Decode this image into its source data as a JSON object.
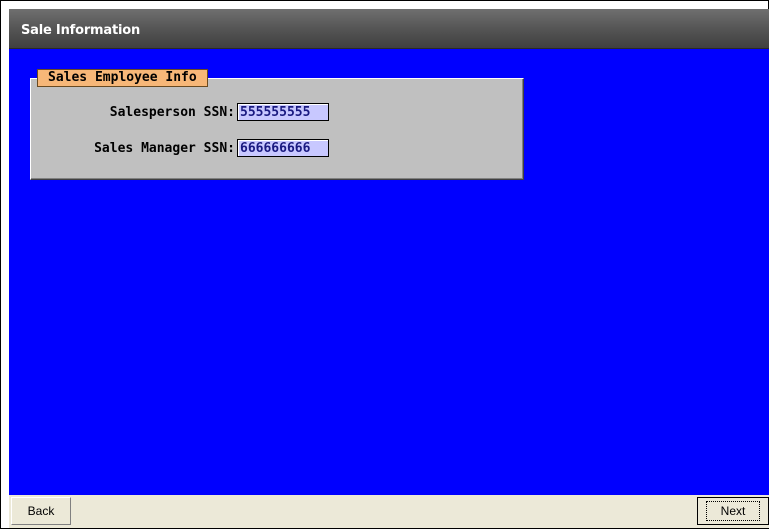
{
  "window": {
    "title": "Sale Information"
  },
  "group": {
    "legend": "Sales Employee Info",
    "fields": [
      {
        "label": "Salesperson SSN:",
        "value": "555555555"
      },
      {
        "label": "Sales Manager SSN:",
        "value": "666666666"
      }
    ]
  },
  "buttons": {
    "back": "Back",
    "next": "Next"
  },
  "colors": {
    "background": "#0000ff",
    "groupbox": "#c0c0c0",
    "legend": "#f7b778",
    "input": "#c8c8ff"
  }
}
